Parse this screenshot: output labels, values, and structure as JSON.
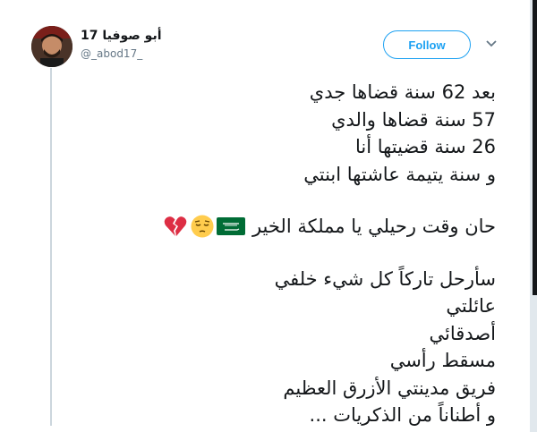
{
  "user": {
    "display_name": "أبو صوفيا 17",
    "handle": "@_abod17_"
  },
  "actions": {
    "follow_label": "Follow"
  },
  "icons": {
    "menu": "chevron-down-icon",
    "flag": "saudi-flag-icon",
    "face": "pensive-face-icon",
    "heart": "broken-heart-icon"
  },
  "colors": {
    "accent": "#1da1f2",
    "text": "#14171a",
    "muted": "#657786"
  },
  "tweet": {
    "lines": [
      "بعد 62 سنة قضاها جدي",
      "57 سنة قضاها والدي",
      "26 سنة قضيتها أنا",
      "و سنة يتيمة عاشتها ابنتي"
    ],
    "farewell_line": "حان وقت رحيلي يا مملكة الخير",
    "closing_lines": [
      "سأرحل تاركاً كل شيء خلفي",
      "عائلتي",
      "أصدقائي",
      "مسقط رأسي",
      "فريق مدينتي الأزرق العظيم",
      "و أطناناً من الذكريات ..."
    ]
  }
}
